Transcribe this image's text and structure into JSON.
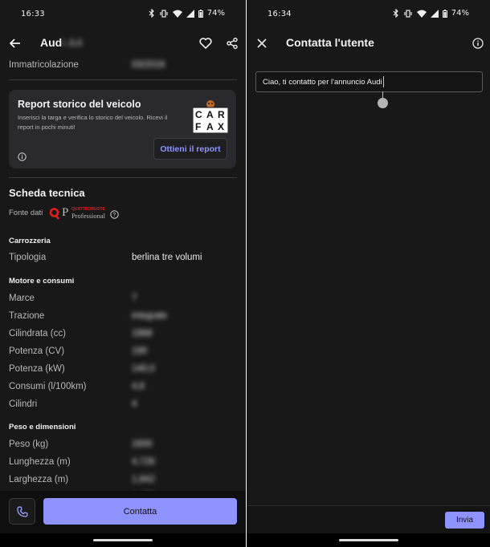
{
  "left": {
    "status": {
      "time": "16:33",
      "battery": "74%"
    },
    "header": {
      "title": "Aud",
      "title_hidden": "i A4"
    },
    "top_row": {
      "label": "Immatricolazione",
      "value": "03/2016"
    },
    "report_card": {
      "title": "Report storico del veicolo",
      "description": "Inserisci la targa e verifica lo storico del veicolo. Ricevi il report in pochi minuti!",
      "logo_letters": [
        "C",
        "A",
        "R",
        "F",
        "A",
        "X"
      ],
      "cta": "Ottieni il report"
    },
    "scheda": {
      "title": "Scheda tecnica",
      "source_label": "Fonte dati",
      "source_logo_small": "QUATTRORUOTE",
      "source_logo_big": "Professional",
      "sections": [
        {
          "title": "Carrozzeria",
          "rows": [
            {
              "label": "Tipologia",
              "value": "berlina tre volumi",
              "hidden": false
            }
          ]
        },
        {
          "title": "Motore e consumi",
          "rows": [
            {
              "label": "Marce",
              "value": "7",
              "hidden": true
            },
            {
              "label": "Trazione",
              "value": "integrale",
              "hidden": true
            },
            {
              "label": "Cilindrata (cc)",
              "value": "1968",
              "hidden": true
            },
            {
              "label": "Potenza (CV)",
              "value": "190",
              "hidden": true
            },
            {
              "label": "Potenza (kW)",
              "value": "140,0",
              "hidden": true
            },
            {
              "label": "Consumi (l/100km)",
              "value": "4,6",
              "hidden": true
            },
            {
              "label": "Cilindri",
              "value": "4",
              "hidden": true
            }
          ]
        },
        {
          "title": "Peso e dimensioni",
          "rows": [
            {
              "label": "Peso (kg)",
              "value": "1600",
              "hidden": true
            },
            {
              "label": "Lunghezza (m)",
              "value": "4,726",
              "hidden": true
            },
            {
              "label": "Larghezza (m)",
              "value": "1,842",
              "hidden": true
            },
            {
              "label": "Altezza (m)",
              "value": "1,455",
              "hidden": true
            }
          ]
        }
      ]
    },
    "bottom": {
      "primary": "Contatta"
    }
  },
  "right": {
    "status": {
      "time": "16:34",
      "battery": "74%"
    },
    "header": {
      "title": "Contatta l'utente"
    },
    "message": {
      "value": "Ciao, ti contatto per l'annuncio Audi"
    },
    "bottom": {
      "send": "Invia"
    }
  },
  "colors": {
    "accent": "#8f93ff",
    "background": "#181818",
    "card": "#2a2a2c"
  }
}
